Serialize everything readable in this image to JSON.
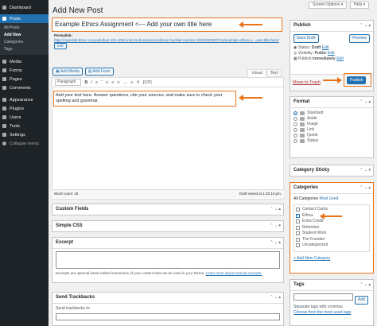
{
  "sidebar": {
    "items": [
      {
        "label": "Dashboard",
        "icon": "dashboard-icon"
      },
      {
        "label": "Posts",
        "icon": "posts-icon",
        "current": true
      }
    ],
    "posts_sub": [
      "All Posts",
      "Add New",
      "Categories",
      "Tags"
    ],
    "items2": [
      {
        "label": "Media",
        "icon": "media-icon"
      },
      {
        "label": "Forms",
        "icon": "forms-icon"
      },
      {
        "label": "Pages",
        "icon": "pages-icon"
      },
      {
        "label": "Comments",
        "icon": "comments-icon"
      },
      {
        "label": "Appearance",
        "icon": "appearance-icon"
      },
      {
        "label": "Plugins",
        "icon": "plugins-icon"
      },
      {
        "label": "Users",
        "icon": "users-icon"
      },
      {
        "label": "Tools",
        "icon": "tools-icon"
      },
      {
        "label": "Settings",
        "icon": "settings-icon"
      },
      {
        "label": "Collapse menu",
        "icon": "collapse-icon"
      }
    ]
  },
  "top": {
    "screen_options": "Screen Options",
    "help": "Help"
  },
  "page_title": "Add New Post",
  "post_title": "Example Ethics Assignment <--- Add your own title here",
  "permalink": {
    "label": "Permalink:",
    "url": "https://openlab.bmcc.cuny.edu/bus-104-e053-intro-to-business-professor-buckler-summer-2022/2022/07/11/example-ethics-a...-own-title-here/",
    "edit": "Edit"
  },
  "editor": {
    "add_media": "Add Media",
    "add_form": "Add Form",
    "tab_visual": "Visual",
    "tab_text": "Text",
    "format_select": "Paragraph",
    "toolbar": [
      "B",
      "I",
      "≡",
      "“",
      "≡",
      "≡",
      "≡",
      "→",
      "≡",
      "✕",
      "[CP]"
    ],
    "content": "Add your text here. Answer questions, cite your sources, and make sure to check your spelling and grammar.",
    "word_count": "Word count: 18",
    "draft_saved": "Draft saved at 1:22:12 pm."
  },
  "boxes": {
    "custom_fields": "Custom Fields",
    "simple_css": "Simple CSS",
    "excerpt": "Excerpt",
    "excerpt_help": "Excerpts are optional hand-crafted summaries of your content that can be used in your theme.",
    "excerpt_link": "Learn more about manual excerpts.",
    "trackbacks": "Send Trackbacks",
    "send_to": "Send trackbacks to:"
  },
  "publish": {
    "title": "Publish",
    "save_draft": "Save Draft",
    "preview": "Preview",
    "status_label": "Status: ",
    "status": "Draft",
    "visibility_label": "Visibility: ",
    "visibility": "Public",
    "publish_label": "Publish ",
    "publish_when": "immediately",
    "edit": "Edit",
    "trash": "Move to Trash",
    "publish_btn": "Publish"
  },
  "format": {
    "title": "Format",
    "options": [
      {
        "label": "Standard",
        "checked": true
      },
      {
        "label": "Aside"
      },
      {
        "label": "Image"
      },
      {
        "label": "Link"
      },
      {
        "label": "Quote"
      },
      {
        "label": "Status"
      }
    ]
  },
  "sticky": {
    "title": "Category Sticky"
  },
  "categories": {
    "title": "Categories",
    "tab_all": "All Categories",
    "tab_used": "Most Used",
    "items": [
      {
        "label": "Contact Cards",
        "checked": false
      },
      {
        "label": "Ethics",
        "checked": true
      },
      {
        "label": "Extra Credit",
        "checked": false
      },
      {
        "label": "Retention",
        "checked": false
      },
      {
        "label": "Student Work",
        "checked": false
      },
      {
        "label": "The Founder",
        "checked": false
      },
      {
        "label": "Uncategorized",
        "checked": false
      }
    ],
    "add_new": "+ Add New Category"
  },
  "tags": {
    "title": "Tags",
    "add": "Add",
    "hint": "Separate tags with commas",
    "choose": "Choose from the most used tags"
  },
  "colors": {
    "accent": "#2271b1",
    "highlight": "#e8741a",
    "sidebar": "#1d2327"
  }
}
